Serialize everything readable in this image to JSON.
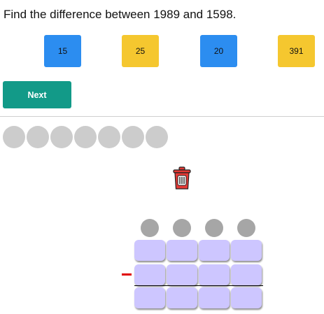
{
  "question": "Find the difference between 1989 and 1598.",
  "choices": [
    {
      "label": "15",
      "color": "#2c8df0"
    },
    {
      "label": "25",
      "color": "#f5c72f"
    },
    {
      "label": "20",
      "color": "#2c8df0"
    },
    {
      "label": "391",
      "color": "#f5c72f"
    }
  ],
  "next_label": "Next",
  "colors": {
    "next": "#129a88",
    "progress_dot": "#cccccc",
    "trash": "#e53935",
    "cell": "#cdc6ff",
    "carry_dot": "#a6a6a6",
    "minus": "#e00000"
  },
  "icons": {
    "trash": "trash-can-icon"
  }
}
